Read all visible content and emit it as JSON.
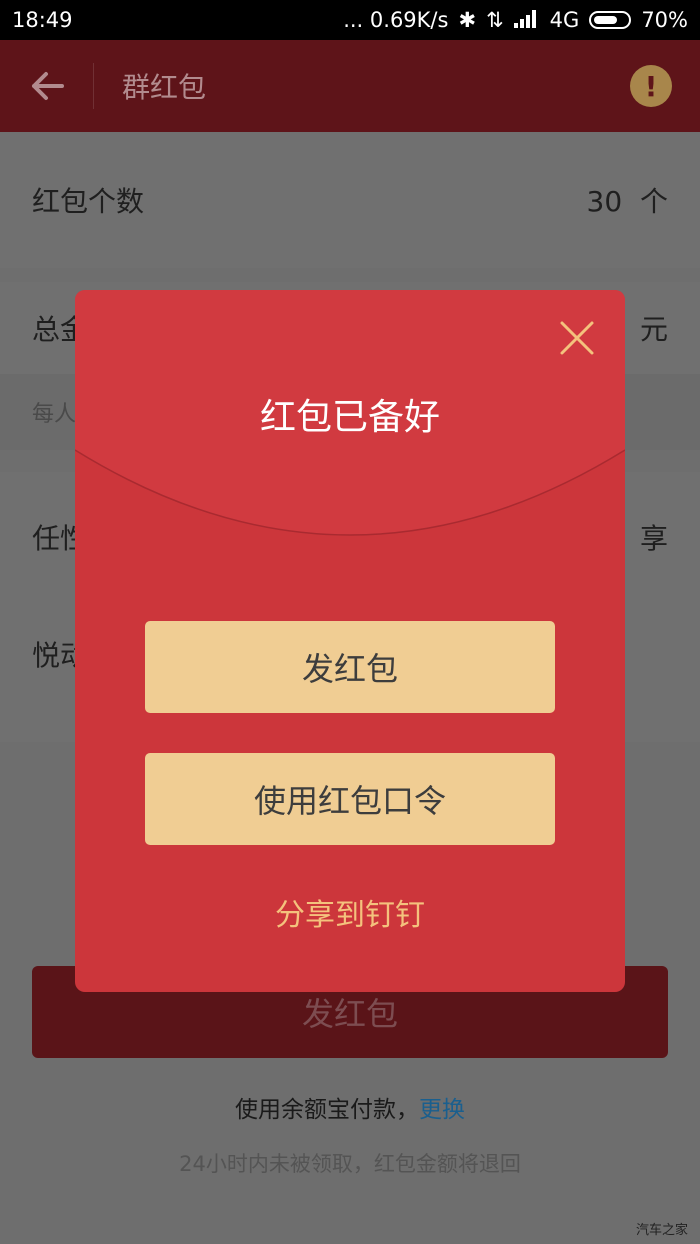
{
  "status": {
    "time": "18:49",
    "network": "... 0.69K/s",
    "network_type": "4G",
    "battery": "70%",
    "battery_level": 0.7
  },
  "header": {
    "title": "群红包",
    "alert_icon": "!"
  },
  "form": {
    "count_label": "红包个数",
    "count_value": "30",
    "count_unit": "个",
    "total_label": "总金额",
    "total_unit": "元",
    "hint": "每人抽到的金额随机",
    "random_label": "任性",
    "random_right": "享",
    "greeting": "悦动"
  },
  "footer": {
    "send_button": "发红包",
    "payment_prefix": "使用余额宝付款，",
    "payment_change": "更换",
    "refund_note": "24小时内未被领取，红包金额将退回"
  },
  "modal": {
    "title": "红包已备好",
    "send_button": "发红包",
    "code_button": "使用红包口令",
    "share_link": "分享到钉钉"
  },
  "watermark": "汽车之家",
  "colors": {
    "modal_red": "#cc363b",
    "button_gold": "#f0cd93",
    "share_text": "#f4c27d"
  }
}
